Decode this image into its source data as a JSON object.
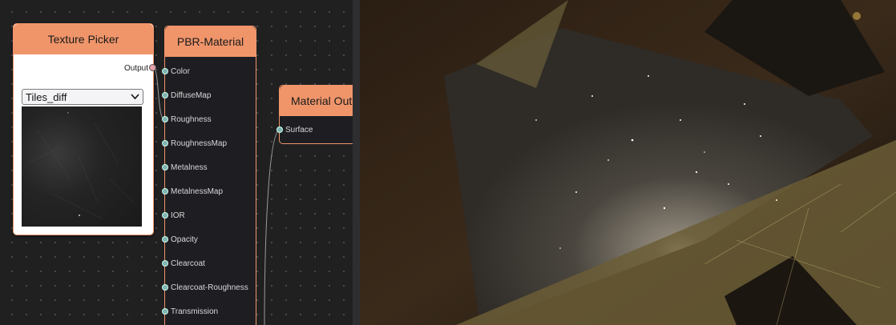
{
  "texture_picker": {
    "title": "Texture Picker",
    "output_label": "Output",
    "selected_texture": "Tiles_diff"
  },
  "pbr_material": {
    "title": "PBR-Material",
    "inputs": [
      "Color",
      "DiffuseMap",
      "Roughness",
      "RoughnessMap",
      "Metalness",
      "MetalnessMap",
      "IOR",
      "Opacity",
      "Clearcoat",
      "Clearcoat-Roughness",
      "Transmission"
    ]
  },
  "material_output": {
    "title": "Material Output",
    "inputs": [
      "Surface"
    ]
  },
  "colors": {
    "accent": "#f0956a",
    "node_bg": "#1e1e22",
    "socket": "#7fb2b0"
  }
}
